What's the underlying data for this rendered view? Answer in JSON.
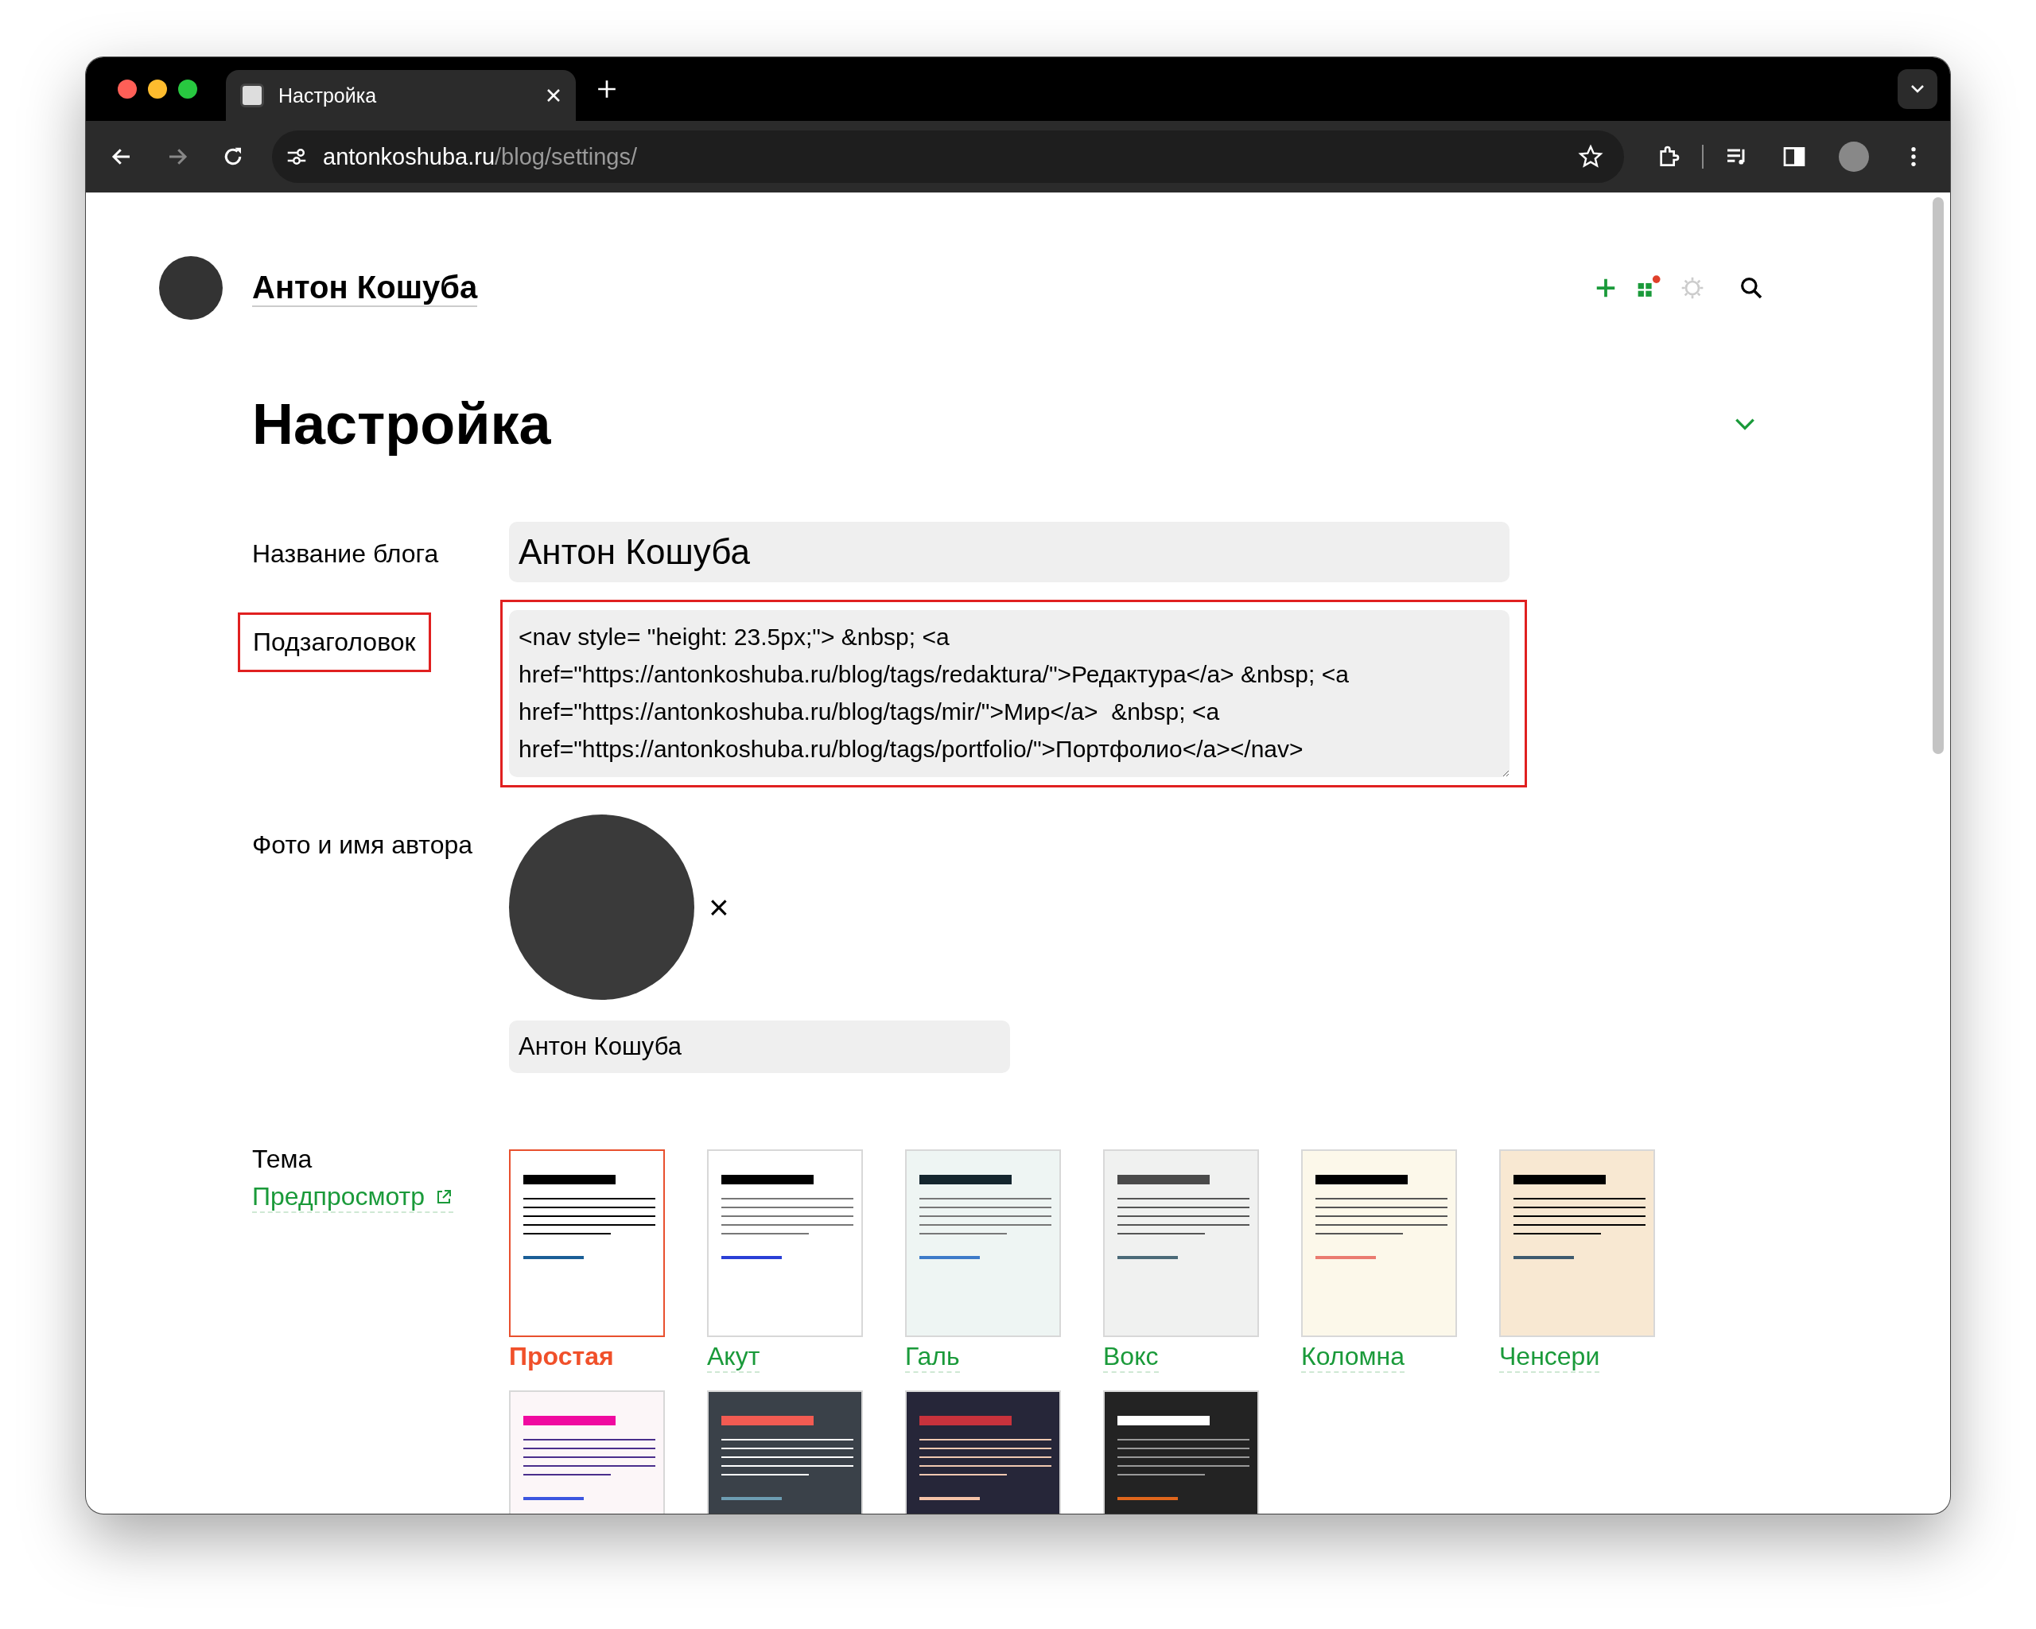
{
  "browser": {
    "tab": {
      "title": "Настройка"
    },
    "url": {
      "host": "antonkoshuba.ru",
      "path": "/blog/settings/"
    }
  },
  "site": {
    "blog_name": "Антон Кошуба",
    "notification_dot": true
  },
  "page_title": "Настройка",
  "form": {
    "blog_title": {
      "label": "Название блога",
      "value": "Антон Кошуба"
    },
    "subtitle": {
      "label": "Подзаголовок",
      "highlighted": true,
      "value": "<nav style= \"height: 23.5px;\"> &nbsp; <a href=\"https://antonkoshuba.ru/blog/tags/redaktura/\">Редактура</a> &nbsp; <a href=\"https://antonkoshuba.ru/blog/tags/mir/\">Мир</a>  &nbsp; <a href=\"https://antonkoshuba.ru/blog/tags/portfolio/\">Портфолио</a></nav>"
    },
    "author": {
      "label": "Фото и имя автора",
      "name": "Антон Кошуба",
      "remove": "×"
    },
    "theme": {
      "label": "Тема",
      "preview_link": "Предпросмотр",
      "themes": [
        {
          "name": "Простая",
          "selected": true,
          "color": "#ffffff",
          "parts": [
            {
              "kind": "heading",
              "color": "#000000"
            },
            {
              "kind": "lines",
              "color": "#000000"
            },
            {
              "kind": "link",
              "color": "#1a5e96"
            }
          ]
        },
        {
          "name": "Акут",
          "selected": false,
          "color": "#ffffff",
          "parts": [
            {
              "kind": "heading",
              "color": "#000000"
            },
            {
              "kind": "lines",
              "color": "#777777"
            },
            {
              "kind": "link",
              "color": "#2a3fd6"
            }
          ]
        },
        {
          "name": "Галь",
          "selected": false,
          "color": "#eef5f3",
          "parts": [
            {
              "kind": "heading",
              "color": "#14262e"
            },
            {
              "kind": "lines",
              "color": "#777777"
            },
            {
              "kind": "link",
              "color": "#3d7bc9"
            }
          ]
        },
        {
          "name": "Вокс",
          "selected": false,
          "color": "#f0f1f0",
          "parts": [
            {
              "kind": "heading",
              "color": "#4a4a4a"
            },
            {
              "kind": "lines",
              "color": "#555555"
            },
            {
              "kind": "link",
              "color": "#4b6a78"
            }
          ]
        },
        {
          "name": "Коломна",
          "selected": false,
          "color": "#fcf8ea",
          "parts": [
            {
              "kind": "heading",
              "color": "#000000"
            },
            {
              "kind": "lines",
              "color": "#555555"
            },
            {
              "kind": "link",
              "color": "#ea7b70"
            }
          ]
        },
        {
          "name": "Ченсери",
          "selected": false,
          "color": "#f8e8d2",
          "parts": [
            {
              "kind": "heading",
              "color": "#000000"
            },
            {
              "kind": "lines",
              "color": "#000000"
            },
            {
              "kind": "link",
              "color": "#3e5a6e"
            }
          ]
        },
        {
          "selected": false,
          "color": "#fcf6f8",
          "parts": [
            {
              "kind": "heading",
              "color": "#f00aa0"
            },
            {
              "kind": "lines",
              "color": "#4a2e8c"
            },
            {
              "kind": "link",
              "color": "#3c56e0"
            }
          ]
        },
        {
          "selected": false,
          "color": "#3a4149",
          "parts": [
            {
              "kind": "heading",
              "color": "#f25b52"
            },
            {
              "kind": "lines",
              "color": "#ffffff"
            },
            {
              "kind": "link",
              "color": "#6d9db2"
            }
          ]
        },
        {
          "selected": false,
          "color": "#262639",
          "parts": [
            {
              "kind": "heading",
              "color": "#c8323c"
            },
            {
              "kind": "lines",
              "color": "#f0c8b0"
            },
            {
              "kind": "link",
              "color": "#f5c3a8"
            }
          ]
        },
        {
          "selected": false,
          "color": "#232323",
          "parts": [
            {
              "kind": "heading",
              "color": "#ffffff"
            },
            {
              "kind": "lines",
              "color": "#999999"
            },
            {
              "kind": "link",
              "color": "#e0661c"
            }
          ]
        }
      ]
    }
  }
}
